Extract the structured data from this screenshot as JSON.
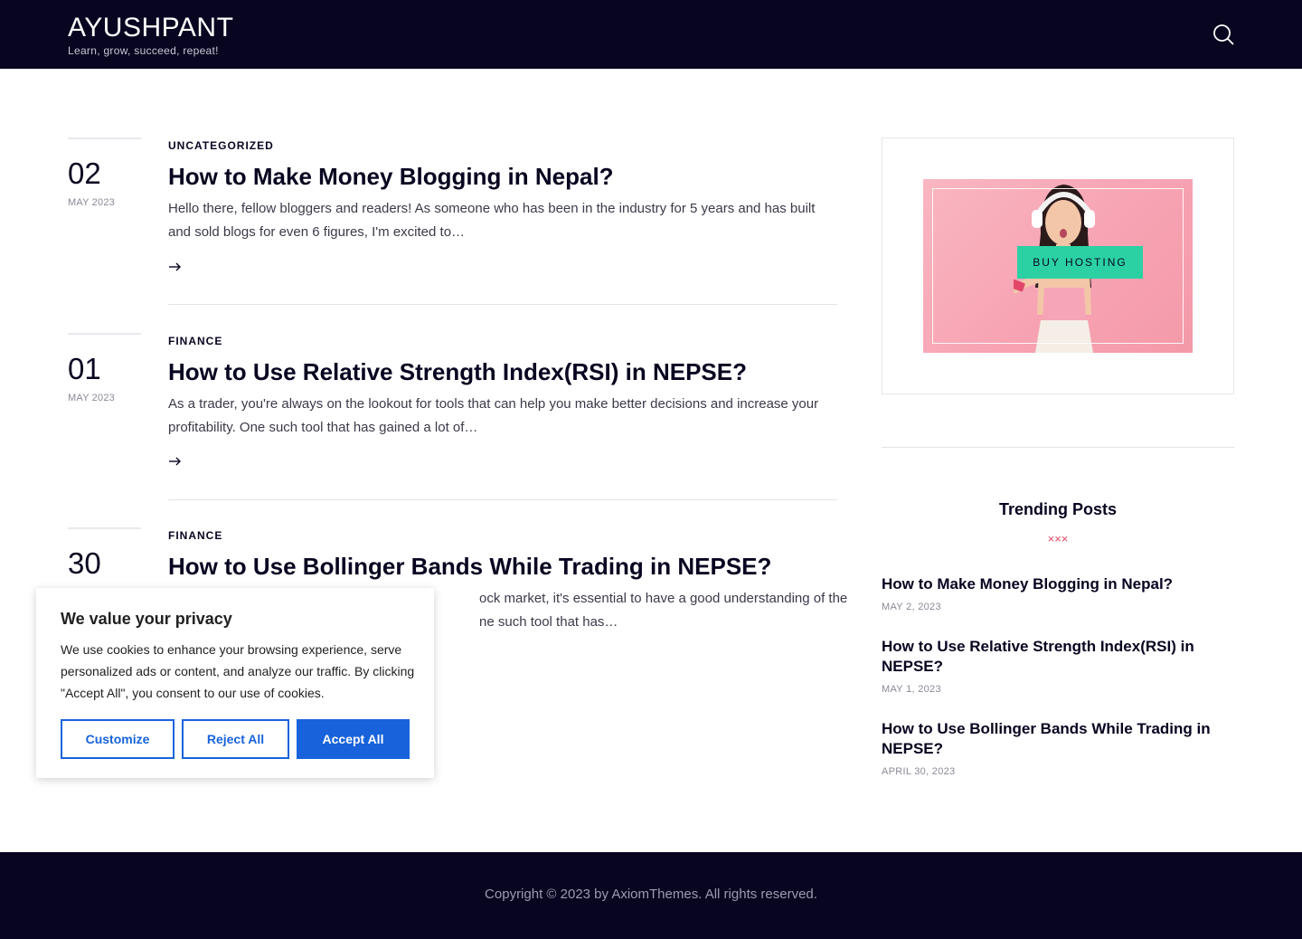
{
  "site": {
    "title": "AYUSHPANT",
    "tagline": "Learn, grow, succeed, repeat!"
  },
  "posts": [
    {
      "day": "02",
      "month": "MAY 2023",
      "category": "UNCATEGORIZED",
      "title": "How to Make Money Blogging in Nepal?",
      "excerpt": "Hello there, fellow bloggers and readers! As someone who has been in the industry for 5 years and has built and sold blogs for even 6 figures, I'm excited to…"
    },
    {
      "day": "01",
      "month": "MAY 2023",
      "category": "FINANCE",
      "title": "How to Use Relative Strength Index(RSI) in NEPSE?",
      "excerpt": "As a trader, you're always on the lookout for tools that can help you make better decisions and increase your profitability. One such tool that has gained a lot of…"
    },
    {
      "day": "30",
      "month": "",
      "category": "FINANCE",
      "title": "How to Use Bollinger Bands While Trading in NEPSE?",
      "excerpt": "ock market, it's essential to have a good understanding of the",
      "excerpt2": "ne such tool that has…"
    }
  ],
  "sidebar": {
    "banner_button": "BUY HOSTING",
    "trending_title": "Trending Posts",
    "trending_deco": "×××",
    "trending": [
      {
        "title": "How to Make Money Blogging in Nepal?",
        "date": "MAY 2, 2023"
      },
      {
        "title": "How to Use Relative Strength Index(RSI) in NEPSE?",
        "date": "MAY 1, 2023"
      },
      {
        "title": "How to Use Bollinger Bands While Trading in NEPSE?",
        "date": "APRIL 30, 2023"
      }
    ]
  },
  "footer": {
    "copyright": "Copyright © 2023 by AxiomThemes. All rights reserved."
  },
  "cookie": {
    "title": "We value your privacy",
    "text": "We use cookies to enhance your browsing experience, serve personalized ads or content, and analyze our traffic. By clicking \"Accept All\", you consent to our use of cookies.",
    "customize": "Customize",
    "reject": "Reject All",
    "accept": "Accept All"
  },
  "colors": {
    "dark": "#070520",
    "accent_button": "#2bd1a3",
    "cookie_blue": "#1863dc",
    "deco_red": "#e0485f"
  }
}
